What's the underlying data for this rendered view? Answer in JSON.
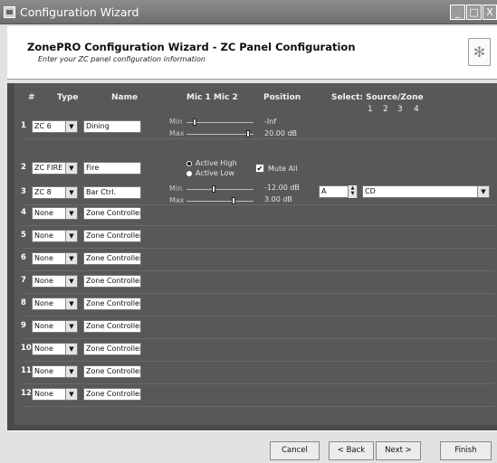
{
  "window": {
    "title": "Configuration Wizard"
  },
  "header": {
    "title": "ZonePRO Configuration Wizard - ZC Panel Configuration",
    "subtitle": "Enter your ZC panel configuration information"
  },
  "columns": {
    "num": "#",
    "type": "Type",
    "name": "Name",
    "mic1": "Mic 1",
    "mic2": "Mic 2",
    "position": "Position",
    "select": "Select: Source/Zone",
    "src_numbers": [
      "1",
      "2",
      "3",
      "4"
    ]
  },
  "rows": [
    {
      "num": "1",
      "type": "ZC 6",
      "name": "Dining"
    },
    {
      "num": "2",
      "type": "ZC FIRE",
      "name": "Fire"
    },
    {
      "num": "3",
      "type": "ZC 8",
      "name": "Bar Ctrl."
    },
    {
      "num": "4",
      "type": "None",
      "name": "Zone Controller"
    },
    {
      "num": "5",
      "type": "None",
      "name": "Zone Controller"
    },
    {
      "num": "6",
      "type": "None",
      "name": "Zone Controller"
    },
    {
      "num": "7",
      "type": "None",
      "name": "Zone Controller"
    },
    {
      "num": "8",
      "type": "None",
      "name": "Zone Controller"
    },
    {
      "num": "9",
      "type": "None",
      "name": "Zone Controller"
    },
    {
      "num": "10",
      "type": "None",
      "name": "Zone Controller"
    },
    {
      "num": "11",
      "type": "None",
      "name": "Zone Controller"
    },
    {
      "num": "12",
      "type": "None",
      "name": "Zone Controller"
    }
  ],
  "zc6": {
    "min_label": "Min",
    "max_label": "Max",
    "min_value": "-Inf",
    "max_value": "20.00 dB"
  },
  "fire": {
    "active_high": "Active High",
    "active_low": "Active Low",
    "mute_all": "Mute All",
    "mute_all_checked": true
  },
  "zc8": {
    "min_label": "Min",
    "max_label": "Max",
    "min_value": "-12.00 dB",
    "max_value": "3.00 dB",
    "source_select": "A",
    "zone_select": "CD"
  },
  "buttons": {
    "cancel": "Cancel",
    "back": "< Back",
    "next": "Next >",
    "finish": "Finish"
  }
}
